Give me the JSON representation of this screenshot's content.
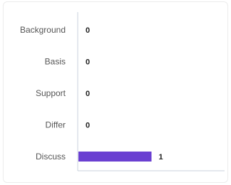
{
  "chart_data": {
    "type": "bar",
    "orientation": "horizontal",
    "categories": [
      "Background",
      "Basis",
      "Support",
      "Differ",
      "Discuss"
    ],
    "values": [
      0,
      0,
      0,
      0,
      1
    ],
    "xlim": [
      0,
      2
    ],
    "title": "",
    "xlabel": "",
    "ylabel": "",
    "grid": false,
    "legend": "none",
    "colors": {
      "bar": "#6a3fd1",
      "axis": "#c9d0dc"
    }
  }
}
